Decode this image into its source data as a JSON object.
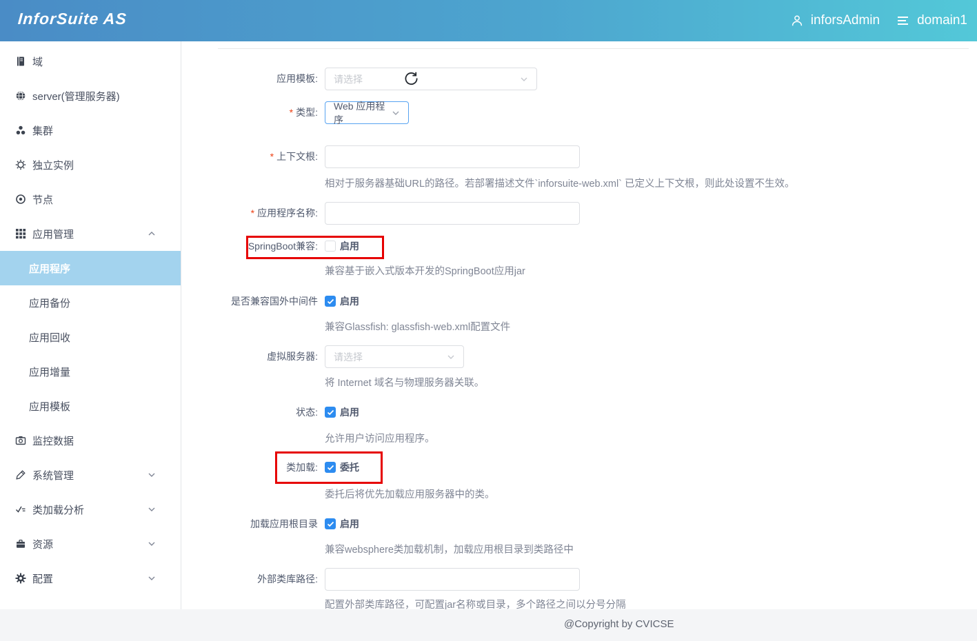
{
  "header": {
    "logo": "InforSuite AS",
    "user": "inforsAdmin",
    "domain": "domain1"
  },
  "sidebar": {
    "items": [
      {
        "label": "域",
        "icon": "book-icon"
      },
      {
        "label": "server(管理服务器)",
        "icon": "globe-icon"
      },
      {
        "label": "集群",
        "icon": "cluster-icon"
      },
      {
        "label": "独立实例",
        "icon": "gear-outline-icon"
      },
      {
        "label": "节点",
        "icon": "node-icon"
      },
      {
        "label": "应用管理",
        "icon": "grid-icon",
        "expanded": true
      },
      {
        "label": "监控数据",
        "icon": "camera-icon"
      },
      {
        "label": "系统管理",
        "icon": "pencil-icon",
        "expanded": false
      },
      {
        "label": "类加载分析",
        "icon": "checklist-icon",
        "expanded": false
      },
      {
        "label": "资源",
        "icon": "briefcase-icon",
        "expanded": false
      },
      {
        "label": "配置",
        "icon": "gear-icon",
        "expanded": false
      }
    ],
    "submenu": [
      {
        "label": "应用程序",
        "active": true
      },
      {
        "label": "应用备份",
        "active": false
      },
      {
        "label": "应用回收",
        "active": false
      },
      {
        "label": "应用增量",
        "active": false
      },
      {
        "label": "应用模板",
        "active": false
      }
    ]
  },
  "form": {
    "required_marker": "*",
    "fields": [
      {
        "label": "应用模板:",
        "type": "select",
        "placeholder": "请选择"
      },
      {
        "label": "类型:",
        "required": true,
        "type": "select",
        "value": "Web 应用程序"
      },
      {
        "label": "上下文根:",
        "required": true,
        "type": "input",
        "value": "",
        "help": "相对于服务器基础URL的路径。若部署描述文件`inforsuite-web.xml` 已定义上下文根，则此处设置不生效。"
      },
      {
        "label": "应用程序名称:",
        "required": true,
        "type": "input",
        "value": ""
      },
      {
        "label": "SpringBoot兼容:",
        "type": "checkbox",
        "checkbox_label": "启用",
        "checked": false,
        "highlighted": true,
        "help": "兼容基于嵌入式版本开发的SpringBoot应用jar"
      },
      {
        "label": "是否兼容国外中间件",
        "type": "checkbox",
        "checkbox_label": "启用",
        "checked": true,
        "help": "兼容Glassfish: glassfish-web.xml配置文件"
      },
      {
        "label": "虚拟服务器:",
        "type": "select",
        "placeholder": "请选择",
        "help": "将 Internet 域名与物理服务器关联。"
      },
      {
        "label": "状态:",
        "type": "checkbox",
        "checkbox_label": "启用",
        "checked": true,
        "help": "允许用户访问应用程序。"
      },
      {
        "label": "类加载:",
        "type": "checkbox",
        "checkbox_label": "委托",
        "checked": true,
        "highlighted": true,
        "help": "委托后将优先加载应用服务器中的类。"
      },
      {
        "label": "加载应用根目录",
        "type": "checkbox",
        "checkbox_label": "启用",
        "checked": true,
        "help": "兼容websphere类加载机制，加载应用根目录到类路径中"
      },
      {
        "label": "外部类库路径:",
        "type": "input",
        "value": "",
        "help": "配置外部类库路径，可配置jar名称或目录，多个路径之间以分号分隔"
      }
    ]
  },
  "footer": {
    "copyright": "@Copyright by CVICSE"
  },
  "colors": {
    "header_gradient_start": "#4a8cc6",
    "header_gradient_end": "#53c8d8",
    "active_item_bg": "#a3d3ee",
    "checkbox_checked": "#2d8cf0",
    "annotation_red": "#e60000",
    "required_red": "#ed4014"
  }
}
